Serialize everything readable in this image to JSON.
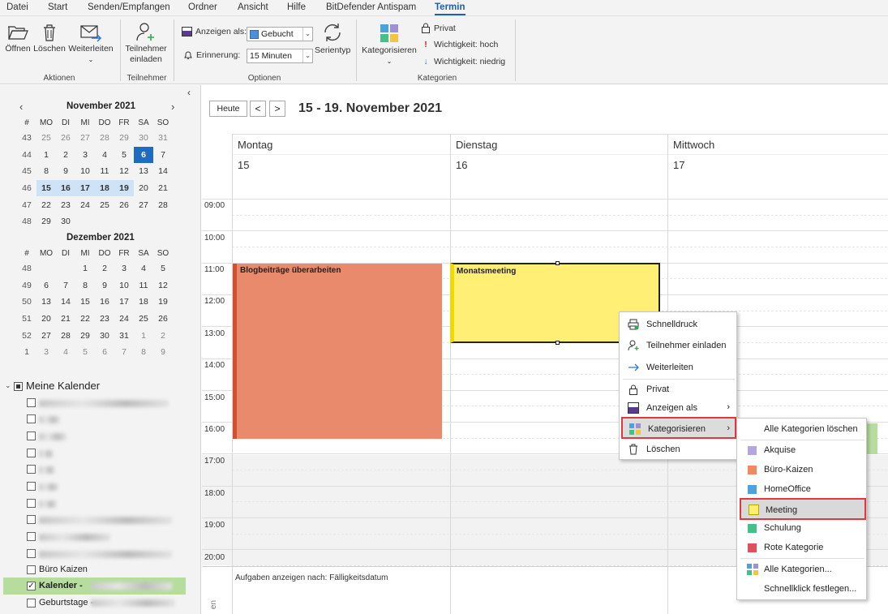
{
  "menu": {
    "items": [
      "Datei",
      "Start",
      "Senden/Empfangen",
      "Ordner",
      "Ansicht",
      "Hilfe",
      "BitDefender Antispam",
      "Termin"
    ],
    "active": "Termin"
  },
  "ribbon": {
    "actions": {
      "open": "Öffnen",
      "delete": "Löschen",
      "forward": "Weiterleiten",
      "group": "Aktionen"
    },
    "attendees": {
      "invite_line1": "Teilnehmer",
      "invite_line2": "einladen",
      "group": "Teilnehmer"
    },
    "options": {
      "show_as_label": "Anzeigen als:",
      "show_as_value": "Gebucht",
      "reminder_label": "Erinnerung:",
      "reminder_value": "15 Minuten",
      "recurrence": "Serientyp",
      "group": "Optionen"
    },
    "categories": {
      "categorize": "Kategorisieren",
      "private": "Privat",
      "high": "Wichtigkeit: hoch",
      "low": "Wichtigkeit: niedrig",
      "group": "Kategorien"
    }
  },
  "minical": {
    "nov_title": "November 2021",
    "dec_title": "Dezember 2021",
    "week_header": "#",
    "weekdays": [
      "MO",
      "DI",
      "MI",
      "DO",
      "FR",
      "SA",
      "SO"
    ],
    "nov_rows": [
      [
        "43",
        "25",
        "26",
        "27",
        "28",
        "29",
        "30",
        "31"
      ],
      [
        "44",
        "1",
        "2",
        "3",
        "4",
        "5",
        "6",
        "7"
      ],
      [
        "45",
        "8",
        "9",
        "10",
        "11",
        "12",
        "13",
        "14"
      ],
      [
        "46",
        "15",
        "16",
        "17",
        "18",
        "19",
        "20",
        "21"
      ],
      [
        "47",
        "22",
        "23",
        "24",
        "25",
        "26",
        "27",
        "28"
      ],
      [
        "48",
        "29",
        "30",
        "",
        "",
        "",
        "",
        ""
      ]
    ],
    "dec_rows": [
      [
        "48",
        "",
        "",
        "1",
        "2",
        "3",
        "4",
        "5"
      ],
      [
        "49",
        "6",
        "7",
        "8",
        "9",
        "10",
        "11",
        "12"
      ],
      [
        "50",
        "13",
        "14",
        "15",
        "16",
        "17",
        "18",
        "19"
      ],
      [
        "51",
        "20",
        "21",
        "22",
        "23",
        "24",
        "25",
        "26"
      ],
      [
        "52",
        "27",
        "28",
        "29",
        "30",
        "31",
        "1",
        "2"
      ],
      [
        "1",
        "3",
        "4",
        "5",
        "6",
        "7",
        "8",
        "9"
      ]
    ]
  },
  "calendars": {
    "group": "Meine Kalender",
    "buero_kaizen": "Büro Kaizen",
    "kalender": "Kalender -",
    "geburtstage": "Geburtstage -"
  },
  "view": {
    "today": "Heute",
    "prev": "<",
    "next": ">",
    "range": "15 - 19. November 2021",
    "days": [
      {
        "name": "Montag",
        "num": "15"
      },
      {
        "name": "Dienstag",
        "num": "16"
      },
      {
        "name": "Mittwoch",
        "num": "17"
      }
    ],
    "times": [
      "09:00",
      "10:00",
      "11:00",
      "12:00",
      "13:00",
      "14:00",
      "15:00",
      "16:00",
      "17:00",
      "18:00",
      "19:00",
      "20:00"
    ],
    "tasks_label": "Aufgaben anzeigen nach: Fälligkeitsdatum",
    "tasks_side": "en"
  },
  "events": {
    "blog": "Blogbeiträge überarbeiten",
    "meeting": "Monatsmeeting"
  },
  "context_menu": {
    "items": [
      "Schnelldruck",
      "Teilnehmer einladen",
      "Weiterleiten",
      "Privat",
      "Anzeigen als",
      "Kategorisieren",
      "Löschen"
    ]
  },
  "category_menu": {
    "clear": "Alle Kategorien löschen",
    "items": [
      {
        "name": "Akquise",
        "color": "#b4a7e0"
      },
      {
        "name": "Büro-Kaizen",
        "color": "#ee8a5e"
      },
      {
        "name": "HomeOffice",
        "color": "#4aa3df"
      },
      {
        "name": "Meeting",
        "color": "#fbef72"
      },
      {
        "name": "Schulung",
        "color": "#46c08a"
      },
      {
        "name": "Rote Kategorie",
        "color": "#e0525b"
      }
    ],
    "all": "Alle Kategorien...",
    "quickclick": "Schnellklick festlegen..."
  },
  "colors": {
    "accent": "#1f5fad",
    "highlight": "#e0383e",
    "blog": "#e98a6d",
    "meeting": "#fff075"
  }
}
